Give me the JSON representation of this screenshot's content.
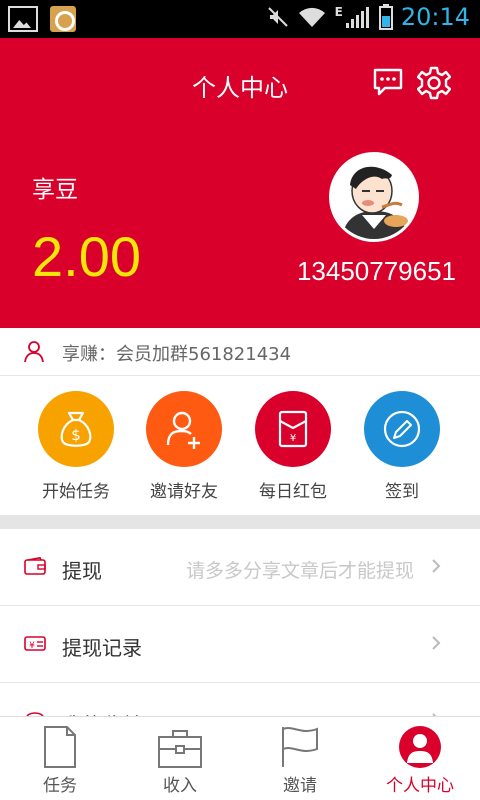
{
  "status_bar": {
    "network_type": "E",
    "time": "20:14",
    "accent_color": "#2fb5e8"
  },
  "header": {
    "title": "个人中心",
    "message_icon": "chat-bubble-icon",
    "settings_icon": "gear-icon",
    "balance_label": "享豆",
    "balance_value": "2.00",
    "phone": "13450779651",
    "brand_color": "#d9002b",
    "balance_color": "#f5e60a"
  },
  "notice": {
    "icon": "person-outline-icon",
    "text": "享赚：会员加群561821434"
  },
  "actions": [
    {
      "label": "开始任务",
      "icon": "money-bag-icon",
      "color": "#f8a200"
    },
    {
      "label": "邀请好友",
      "icon": "add-user-icon",
      "color": "#ff5a11"
    },
    {
      "label": "每日红包",
      "icon": "red-envelope-icon",
      "color": "#d9002b"
    },
    {
      "label": "签到",
      "icon": "pencil-icon",
      "color": "#1e8fd6"
    }
  ],
  "menu": [
    {
      "label": "提现",
      "hint": "请多多分享文章后才能提现",
      "icon": "wallet-icon"
    },
    {
      "label": "提现记录",
      "hint": "",
      "icon": "yen-card-icon"
    },
    {
      "label": "我的收益",
      "hint": "",
      "icon": "coins-icon"
    }
  ],
  "bottom_nav": [
    {
      "label": "任务",
      "icon": "document-icon",
      "active": false
    },
    {
      "label": "收入",
      "icon": "briefcase-icon",
      "active": false
    },
    {
      "label": "邀请",
      "icon": "flag-icon",
      "active": false
    },
    {
      "label": "个人中心",
      "icon": "user-icon",
      "active": true
    }
  ]
}
